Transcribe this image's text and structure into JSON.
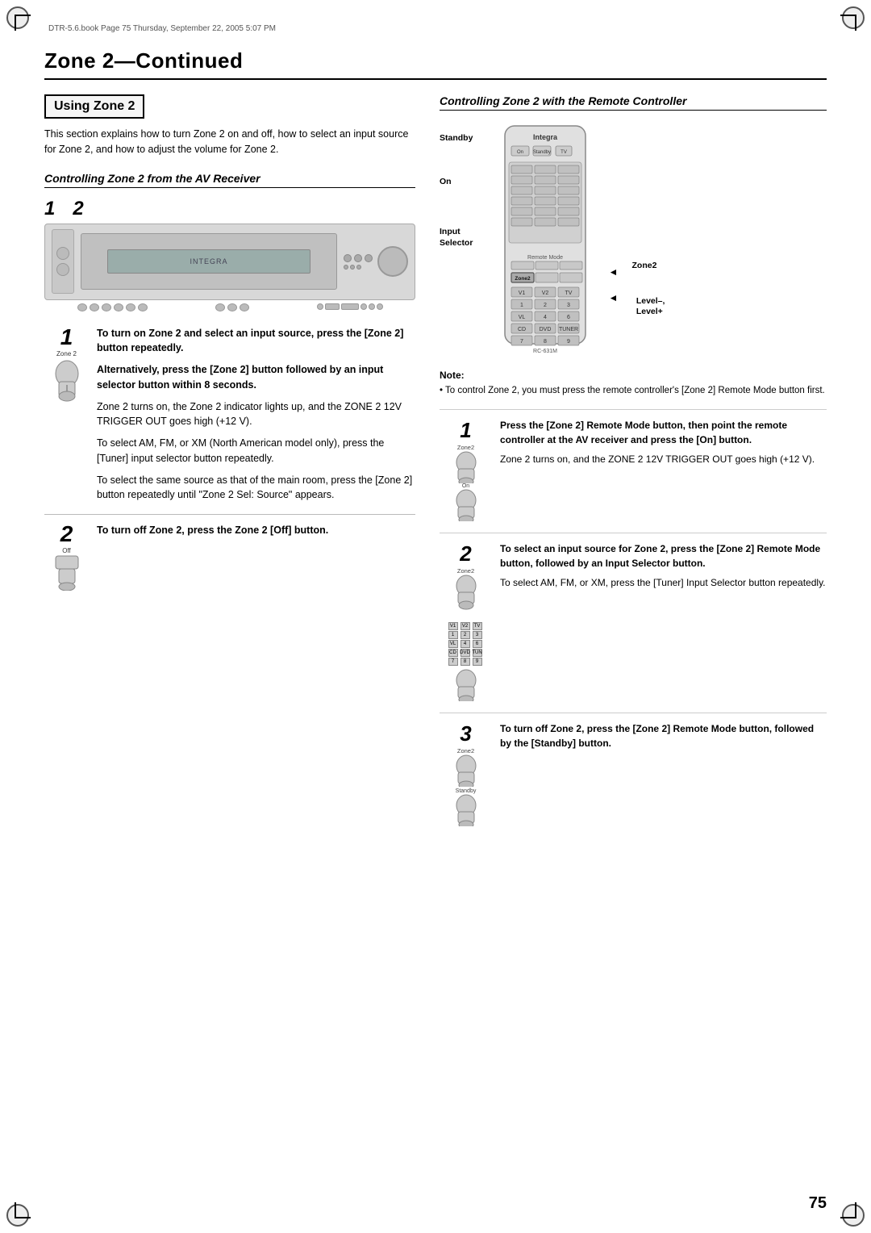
{
  "file_info": "DTR-5.6.book  Page 75  Thursday, September 22, 2005  5:07 PM",
  "page_title": "Zone 2",
  "page_title_suffix": "—Continued",
  "page_number": "75",
  "left_column": {
    "using_zone_heading": "Using Zone 2",
    "intro_text": "This section explains how to turn Zone 2 on and off, how to select an input source for Zone 2, and how to adjust the volume for Zone 2.",
    "av_receiver_heading": "Controlling Zone 2 from the AV Receiver",
    "step1": {
      "num": "1",
      "bold_text": "To turn on Zone 2 and select an input source, press the [Zone 2] button repeatedly.",
      "alt_bold": "Alternatively, press the [Zone 2] button followed by an input selector button within 8 seconds.",
      "body1": "Zone 2 turns on, the Zone 2 indicator lights up, and the ZONE 2 12V TRIGGER OUT goes high (+12 V).",
      "body2": "To select AM, FM, or XM (North American model only), press the [Tuner] input selector button repeatedly.",
      "body3": "To select the same source as that of the main room, press the [Zone 2] button repeatedly until \"Zone 2 Sel: Source\" appears."
    },
    "step2": {
      "num": "2",
      "bold_text": "To turn off Zone 2, press the Zone 2 [Off] button.",
      "off_label": "Off"
    }
  },
  "right_column": {
    "heading": "Controlling Zone 2 with the Remote Controller",
    "labels": {
      "standby": "Standby",
      "on": "On",
      "input_selector": "Input\nSelector",
      "zone2": "Zone2",
      "level": "Level–,\nLevel+"
    },
    "remote_model": "RC-631M",
    "integra_label": "Integra",
    "note_title": "Note:",
    "note_text": "• To control Zone 2, you must press the remote controller's [Zone 2] Remote Mode button first.",
    "step1": {
      "num": "1",
      "bold_text": "Press the [Zone 2] Remote Mode button, then point the remote controller at the AV receiver and press the [On] button.",
      "body": "Zone 2 turns on, and the ZONE 2 12V TRIGGER OUT goes high (+12 V)."
    },
    "step2": {
      "num": "2",
      "bold_text": "To select an input source for Zone 2, press the [Zone 2] Remote Mode button, followed by an Input Selector button.",
      "body": "To select AM, FM, or XM, press the [Tuner] Input Selector button repeatedly."
    },
    "step3": {
      "num": "3",
      "bold_text": "To turn off Zone 2, press the [Zone 2] Remote Mode button, followed by the [Standby] button."
    }
  }
}
